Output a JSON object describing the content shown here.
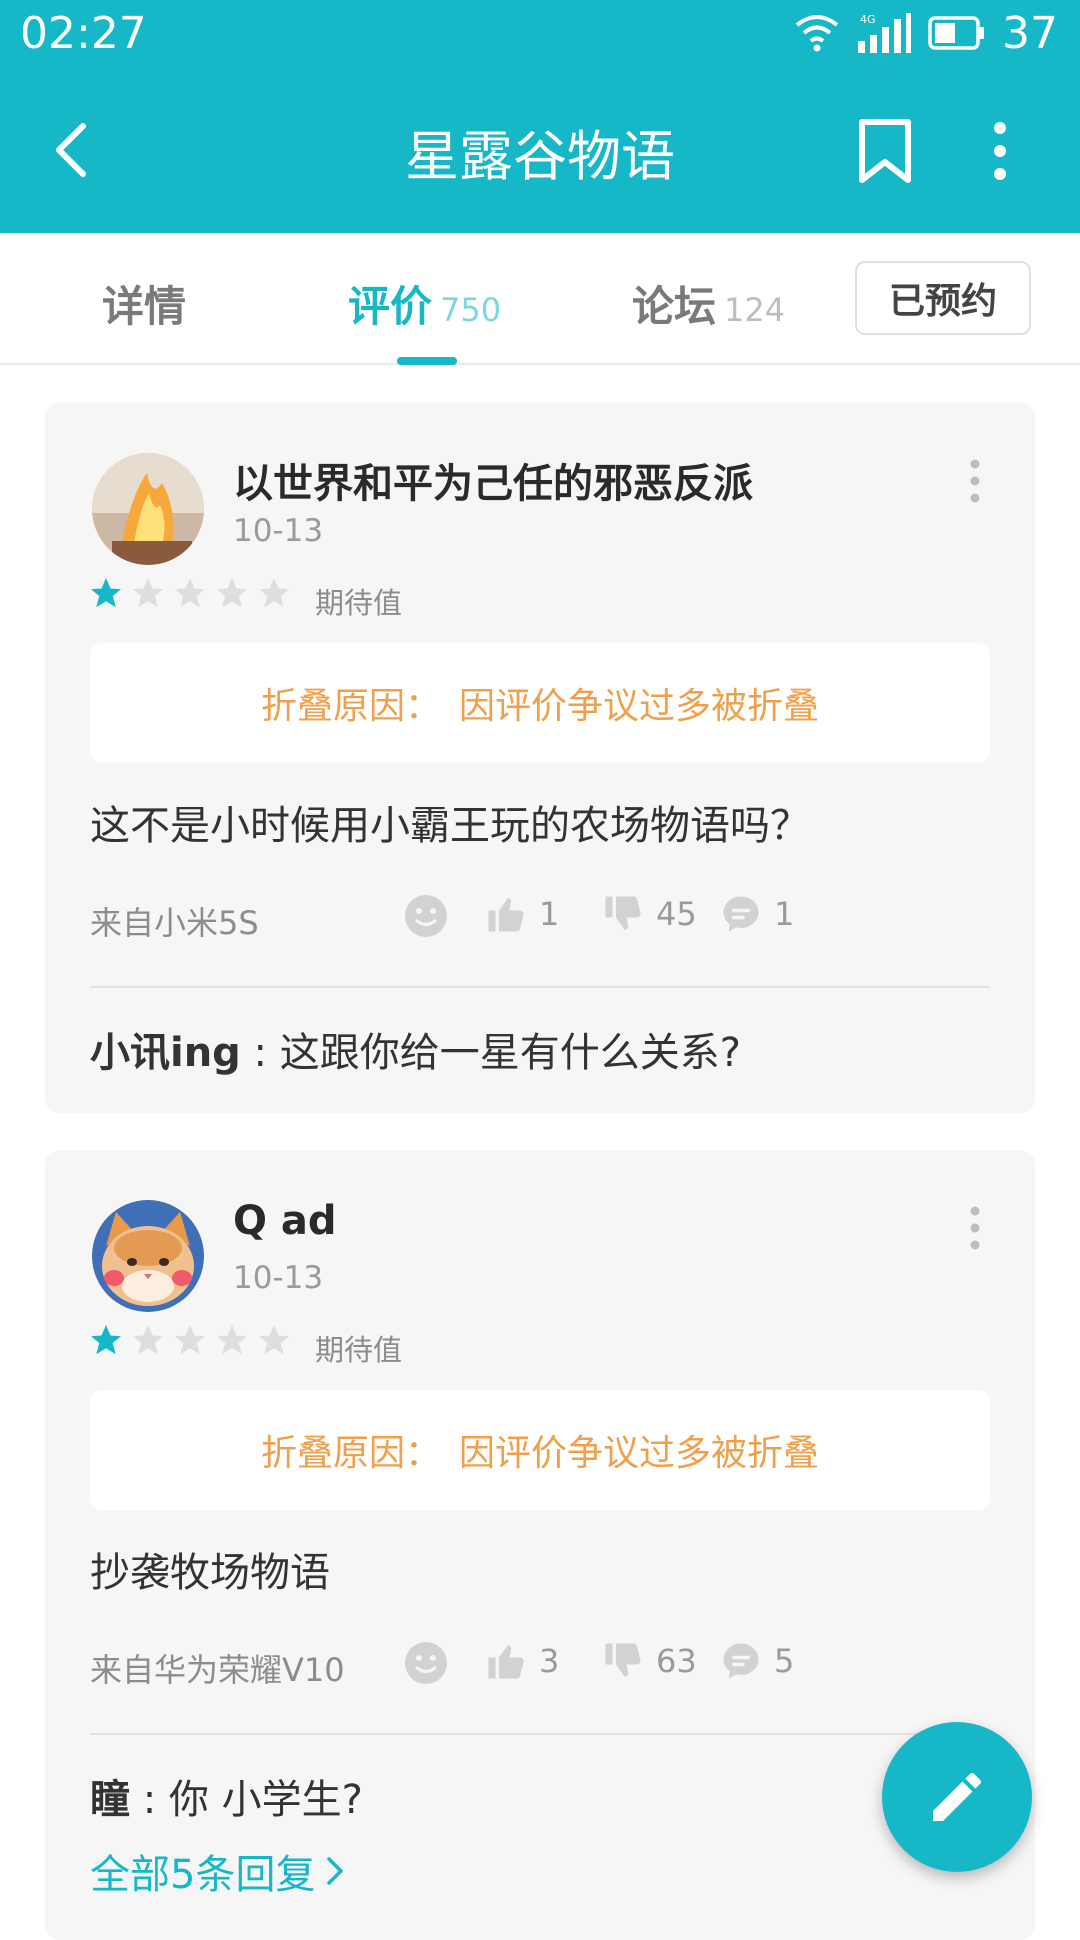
{
  "status_bar": {
    "time": "02:27",
    "network": "4G",
    "battery": "37"
  },
  "app_bar": {
    "title": "星露谷物语"
  },
  "tabs": [
    {
      "label": "详情",
      "count": ""
    },
    {
      "label": "评价",
      "count": "750"
    },
    {
      "label": "论坛",
      "count": "124"
    }
  ],
  "reserve_button": "已预约",
  "colors": {
    "accent": "#16b7c6",
    "fold": "#f0a04b"
  },
  "reviews": [
    {
      "username": "以世界和平为己任的邪恶反派",
      "date": "10-13",
      "rating": 1,
      "rating_label": "期待值",
      "fold_prefix": "折叠原因：",
      "fold_reason": "因评价争议过多被折叠",
      "content": "这不是小时候用小霸王玩的农场物语吗？",
      "device": "来自小米5S",
      "likes": "1",
      "dislikes": "45",
      "comments": "1",
      "reply_user": "小讯ing",
      "reply_text": " : 这跟你给一星有什么关系?"
    },
    {
      "username": "Q ad",
      "date": "10-13",
      "rating": 1,
      "rating_label": "期待值",
      "fold_prefix": "折叠原因：",
      "fold_reason": "因评价争议过多被折叠",
      "content": "抄袭牧场物语",
      "device": "来自华为荣耀V10",
      "likes": "3",
      "dislikes": "63",
      "comments": "5",
      "reply_user": "瞳",
      "reply_text": " : 你 小学生?",
      "all_replies": "全部5条回复"
    }
  ]
}
